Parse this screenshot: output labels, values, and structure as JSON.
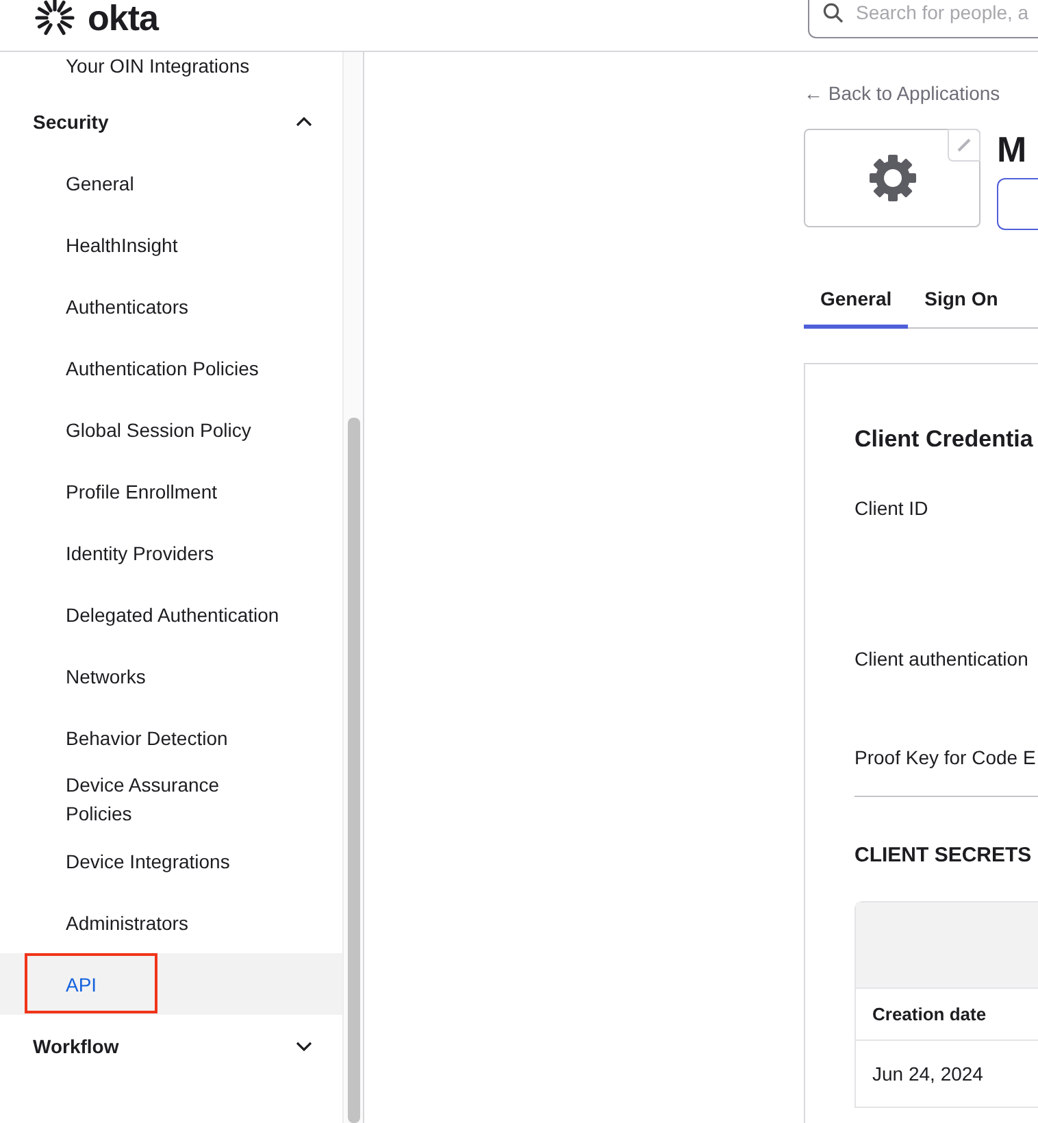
{
  "header": {
    "logo": "okta",
    "search": {
      "placeholder": "Search for people, a"
    }
  },
  "sidebar": {
    "items": [
      {
        "label": "Your OIN Integrations",
        "selected": false,
        "annotated": false
      },
      {
        "label": "Security",
        "kind": "section",
        "expanded": true,
        "children": [
          {
            "label": "General",
            "selected": false,
            "annotated": false
          },
          {
            "label": "HealthInsight",
            "selected": false,
            "annotated": false
          },
          {
            "label": "Authenticators",
            "selected": false,
            "annotated": false
          },
          {
            "label": "Authentication Policies",
            "selected": false,
            "annotated": false
          },
          {
            "label": "Global Session Policy",
            "selected": false,
            "annotated": false
          },
          {
            "label": "Profile Enrollment",
            "selected": false,
            "annotated": false
          },
          {
            "label": "Identity Providers",
            "selected": false,
            "annotated": false
          },
          {
            "label": "Delegated Authentication",
            "selected": false,
            "annotated": false
          },
          {
            "label": "Networks",
            "selected": false,
            "annotated": false
          },
          {
            "label": "Behavior Detection",
            "selected": false,
            "annotated": false
          },
          {
            "label": "Device Assurance Policies",
            "selected": false,
            "annotated": false
          },
          {
            "label": "Device Integrations",
            "selected": false,
            "annotated": false
          },
          {
            "label": "Administrators",
            "selected": false,
            "annotated": false
          },
          {
            "label": "API",
            "selected": true,
            "annotated": true
          }
        ]
      },
      {
        "label": "Workflow",
        "kind": "section",
        "expanded": false
      }
    ]
  },
  "main": {
    "back_link": "← Back to Applications",
    "app_title": "M",
    "tabs": [
      {
        "label": "General",
        "selected": true
      },
      {
        "label": "Sign On",
        "selected": false
      }
    ],
    "card": {
      "title": "Client Credentia",
      "fields": [
        "Client ID",
        "Client authentication",
        "Proof Key for Code E"
      ],
      "secrets": {
        "heading": "CLIENT SECRETS",
        "columns": [
          "Creation date"
        ],
        "rows": [
          [
            "Jun 24, 2024"
          ]
        ]
      }
    }
  }
}
